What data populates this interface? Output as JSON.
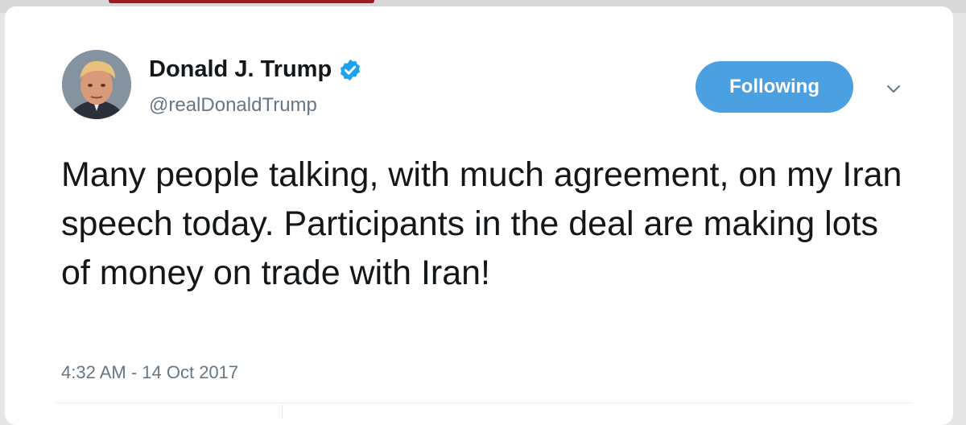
{
  "tweet": {
    "author": {
      "display_name": "Donald J. Trump",
      "handle": "@realDonaldTrump",
      "verified": true,
      "avatar_icon": "profile-photo"
    },
    "follow_button_label": "Following",
    "text": "Many people talking, with much agreement, on my Iran speech today. Participants in the deal are making lots of money on trade with Iran!",
    "timestamp": "4:32 AM - 14 Oct 2017"
  },
  "colors": {
    "accent": "#4aa0e0",
    "verified_badge": "#1da1f2",
    "secondary_text": "#657786"
  }
}
